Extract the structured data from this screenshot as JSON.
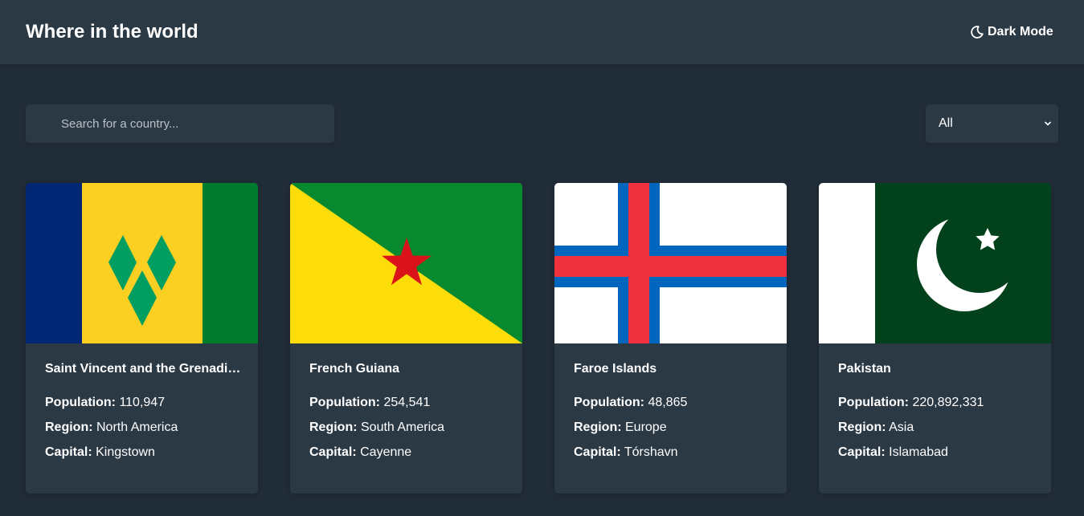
{
  "header": {
    "title": "Where in the world",
    "dark_mode_label": "Dark Mode",
    "dark_mode_icon": "moon-icon"
  },
  "search": {
    "placeholder": "Search for a country...",
    "value": ""
  },
  "filter": {
    "selected": "All",
    "icon": "chevron-down-icon"
  },
  "labels": {
    "population": "Population:",
    "region": "Region:",
    "capital": "Capital:"
  },
  "countries": [
    {
      "name": "Saint Vincent and the Grenadines",
      "population": "110,947",
      "region": "North America",
      "capital": "Kingstown",
      "flag": "saint-vincent-flag"
    },
    {
      "name": "French Guiana",
      "population": "254,541",
      "region": "South America",
      "capital": "Cayenne",
      "flag": "french-guiana-flag"
    },
    {
      "name": "Faroe Islands",
      "population": "48,865",
      "region": "Europe",
      "capital": "Tórshavn",
      "flag": "faroe-islands-flag"
    },
    {
      "name": "Pakistan",
      "population": "220,892,331",
      "region": "Asia",
      "capital": "Islamabad",
      "flag": "pakistan-flag"
    }
  ],
  "colors": {
    "background": "#202c37",
    "surface": "#2b3945",
    "text": "#ffffff"
  }
}
